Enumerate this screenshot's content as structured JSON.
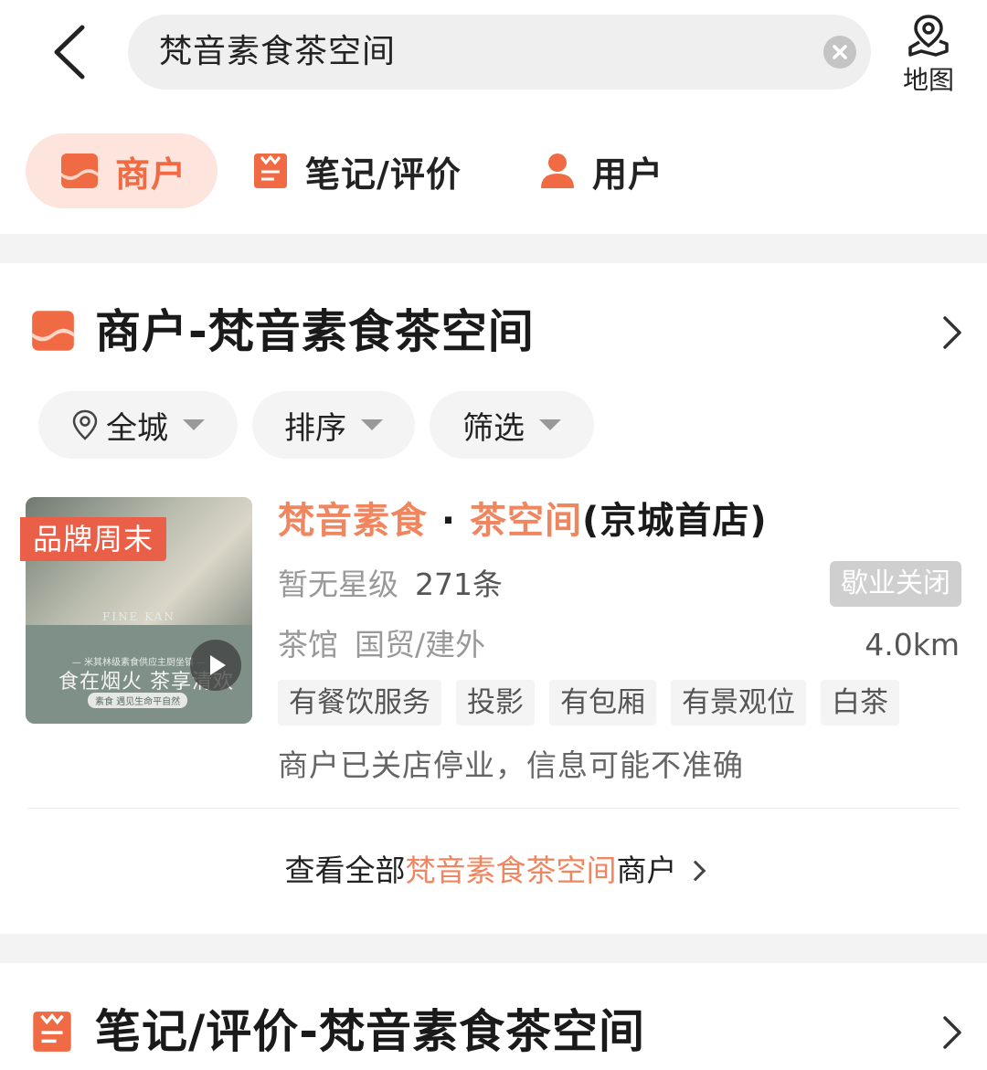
{
  "search": {
    "query": "梵音素食茶空间",
    "map_label": "地图"
  },
  "tabs": [
    {
      "label": "商户",
      "active": true
    },
    {
      "label": "笔记/评价",
      "active": false
    },
    {
      "label": "用户",
      "active": false
    }
  ],
  "merchant_section": {
    "title": "商户-梵音素食茶空间"
  },
  "filters": {
    "city": "全城",
    "sort": "排序",
    "filter": "筛选"
  },
  "merchant": {
    "badge": "品牌周末",
    "name_part1": "梵音素食",
    "name_sep": " · ",
    "name_part2": "茶空间",
    "name_suffix": "(京城首店)",
    "rating": "暂无星级",
    "review_count": "271条",
    "status": "歇业关闭",
    "category": "茶馆",
    "area": "国贸/建外",
    "distance": "4.0km",
    "tags": [
      "有餐饮服务",
      "投影",
      "有包厢",
      "有景观位",
      "白茶"
    ],
    "notice": "商户已关店停业，信息可能不准确",
    "thumb_brand": "FINE KAN",
    "thumb_line": "— 米其林级素食供应主厨坐镇 —",
    "thumb_slogan": "食在烟火 茶享清欢",
    "thumb_sub": "素食 遇见生命平自然"
  },
  "view_all": {
    "prefix": "查看全部",
    "keyword": "梵音素食茶空间",
    "suffix": "商户"
  },
  "notes_section": {
    "title": "笔记/评价-梵音素食茶空间"
  },
  "colors": {
    "accent": "#f06a43",
    "highlight": "#f0865f",
    "tab_active_bg": "#fde4dc",
    "badge_red": "#e95f48"
  }
}
